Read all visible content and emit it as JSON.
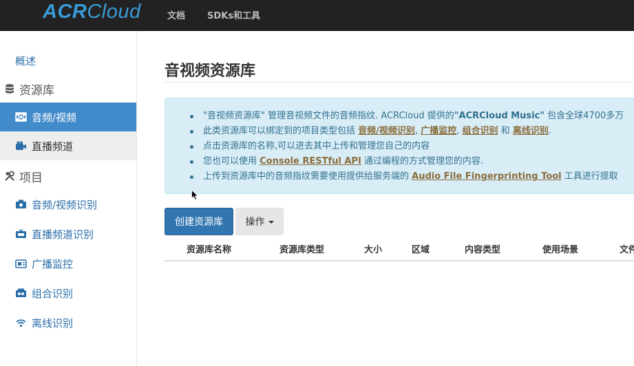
{
  "navbar": {
    "logo_main": "ACR",
    "logo_thin": "Cloud",
    "links": [
      "文档",
      "SDKs和工具"
    ]
  },
  "sidebar": {
    "overview": "概述",
    "group_library": "资源库",
    "library_items": [
      "音频/视频",
      "直播频道"
    ],
    "group_project": "项目",
    "project_items": [
      "音频/视频识别",
      "直播频道识别",
      "广播监控",
      "组合识别",
      "离线识别"
    ]
  },
  "main": {
    "title": "音视频资源库",
    "info": {
      "l1_a": "\"音视频资源库\" 管理音视频文件的音频指纹. ACRCloud 提供的",
      "l1_b": "\"ACRCloud Music\"",
      "l1_c": " 包含全球4700多万",
      "l2_a": "此类资源库可以绑定到的项目类型包括 ",
      "l2_link1": "音频/视频识别",
      "l2_sep1": ", ",
      "l2_link2": "广播监控",
      "l2_sep2": ", ",
      "l2_link3": "组合识别",
      "l2_and": " 和 ",
      "l2_link4": "离线识别",
      "l2_end": ".",
      "l3": "点击资源库的名称,可以进去其中上传和管理您自己的内容",
      "l4_a": "您也可以使用 ",
      "l4_link": "Console RESTful API",
      "l4_b": " 通过编程的方式管理您的内容.",
      "l5_a": "上传到资源库中的音频指纹需要使用提供给服务端的 ",
      "l5_link": "Audio File Fingerprinting Tool",
      "l5_b": " 工具进行提取"
    },
    "create_button": "创建资源库",
    "actions_button": "操作",
    "table_headers": [
      "资源库名称",
      "资源库类型",
      "大小",
      "区域",
      "内容类型",
      "使用场景",
      "文件"
    ]
  },
  "colors": {
    "navbar_bg": "#222222",
    "logo": "#3a9bd8",
    "active": "#428bca",
    "info_bg": "#d9edf7",
    "info_text": "#31708f",
    "link_brown": "#8a6d3b",
    "primary_btn": "#3276b1"
  }
}
